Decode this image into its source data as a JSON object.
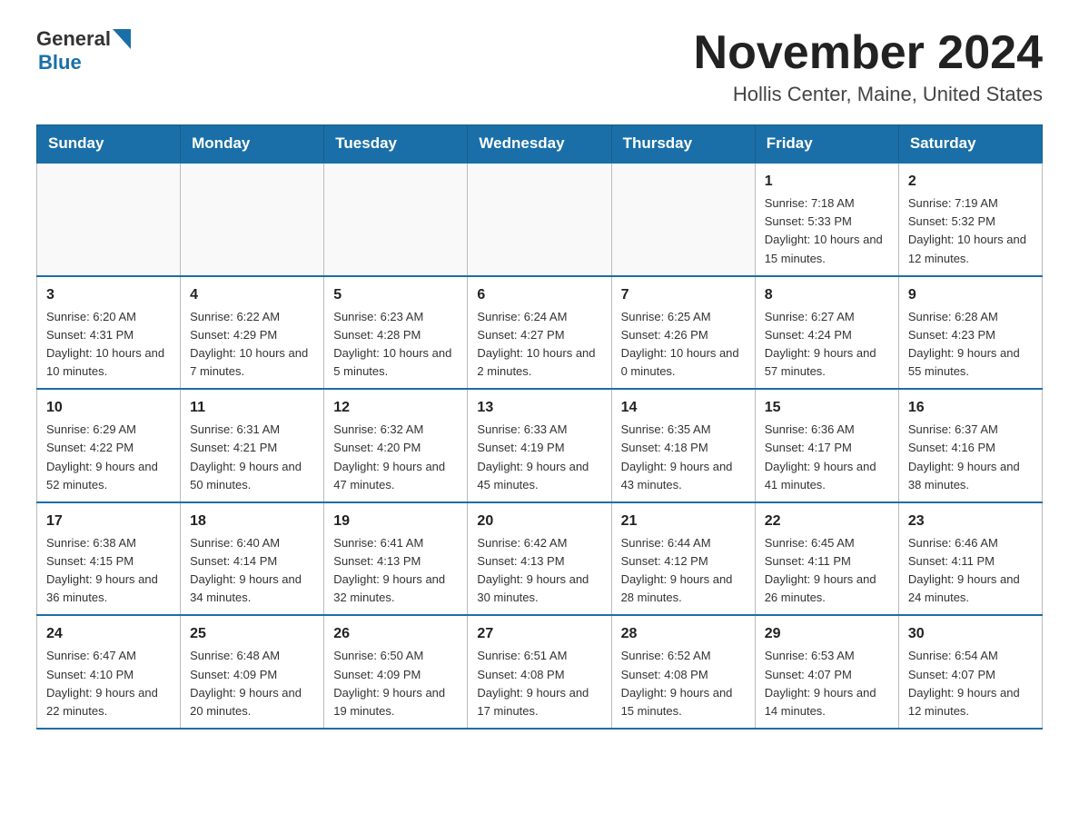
{
  "header": {
    "logo_general": "General",
    "logo_blue": "Blue",
    "month_title": "November 2024",
    "location": "Hollis Center, Maine, United States"
  },
  "days_of_week": [
    "Sunday",
    "Monday",
    "Tuesday",
    "Wednesday",
    "Thursday",
    "Friday",
    "Saturday"
  ],
  "weeks": [
    [
      {
        "day": "",
        "info": ""
      },
      {
        "day": "",
        "info": ""
      },
      {
        "day": "",
        "info": ""
      },
      {
        "day": "",
        "info": ""
      },
      {
        "day": "",
        "info": ""
      },
      {
        "day": "1",
        "info": "Sunrise: 7:18 AM\nSunset: 5:33 PM\nDaylight: 10 hours and 15 minutes."
      },
      {
        "day": "2",
        "info": "Sunrise: 7:19 AM\nSunset: 5:32 PM\nDaylight: 10 hours and 12 minutes."
      }
    ],
    [
      {
        "day": "3",
        "info": "Sunrise: 6:20 AM\nSunset: 4:31 PM\nDaylight: 10 hours and 10 minutes."
      },
      {
        "day": "4",
        "info": "Sunrise: 6:22 AM\nSunset: 4:29 PM\nDaylight: 10 hours and 7 minutes."
      },
      {
        "day": "5",
        "info": "Sunrise: 6:23 AM\nSunset: 4:28 PM\nDaylight: 10 hours and 5 minutes."
      },
      {
        "day": "6",
        "info": "Sunrise: 6:24 AM\nSunset: 4:27 PM\nDaylight: 10 hours and 2 minutes."
      },
      {
        "day": "7",
        "info": "Sunrise: 6:25 AM\nSunset: 4:26 PM\nDaylight: 10 hours and 0 minutes."
      },
      {
        "day": "8",
        "info": "Sunrise: 6:27 AM\nSunset: 4:24 PM\nDaylight: 9 hours and 57 minutes."
      },
      {
        "day": "9",
        "info": "Sunrise: 6:28 AM\nSunset: 4:23 PM\nDaylight: 9 hours and 55 minutes."
      }
    ],
    [
      {
        "day": "10",
        "info": "Sunrise: 6:29 AM\nSunset: 4:22 PM\nDaylight: 9 hours and 52 minutes."
      },
      {
        "day": "11",
        "info": "Sunrise: 6:31 AM\nSunset: 4:21 PM\nDaylight: 9 hours and 50 minutes."
      },
      {
        "day": "12",
        "info": "Sunrise: 6:32 AM\nSunset: 4:20 PM\nDaylight: 9 hours and 47 minutes."
      },
      {
        "day": "13",
        "info": "Sunrise: 6:33 AM\nSunset: 4:19 PM\nDaylight: 9 hours and 45 minutes."
      },
      {
        "day": "14",
        "info": "Sunrise: 6:35 AM\nSunset: 4:18 PM\nDaylight: 9 hours and 43 minutes."
      },
      {
        "day": "15",
        "info": "Sunrise: 6:36 AM\nSunset: 4:17 PM\nDaylight: 9 hours and 41 minutes."
      },
      {
        "day": "16",
        "info": "Sunrise: 6:37 AM\nSunset: 4:16 PM\nDaylight: 9 hours and 38 minutes."
      }
    ],
    [
      {
        "day": "17",
        "info": "Sunrise: 6:38 AM\nSunset: 4:15 PM\nDaylight: 9 hours and 36 minutes."
      },
      {
        "day": "18",
        "info": "Sunrise: 6:40 AM\nSunset: 4:14 PM\nDaylight: 9 hours and 34 minutes."
      },
      {
        "day": "19",
        "info": "Sunrise: 6:41 AM\nSunset: 4:13 PM\nDaylight: 9 hours and 32 minutes."
      },
      {
        "day": "20",
        "info": "Sunrise: 6:42 AM\nSunset: 4:13 PM\nDaylight: 9 hours and 30 minutes."
      },
      {
        "day": "21",
        "info": "Sunrise: 6:44 AM\nSunset: 4:12 PM\nDaylight: 9 hours and 28 minutes."
      },
      {
        "day": "22",
        "info": "Sunrise: 6:45 AM\nSunset: 4:11 PM\nDaylight: 9 hours and 26 minutes."
      },
      {
        "day": "23",
        "info": "Sunrise: 6:46 AM\nSunset: 4:11 PM\nDaylight: 9 hours and 24 minutes."
      }
    ],
    [
      {
        "day": "24",
        "info": "Sunrise: 6:47 AM\nSunset: 4:10 PM\nDaylight: 9 hours and 22 minutes."
      },
      {
        "day": "25",
        "info": "Sunrise: 6:48 AM\nSunset: 4:09 PM\nDaylight: 9 hours and 20 minutes."
      },
      {
        "day": "26",
        "info": "Sunrise: 6:50 AM\nSunset: 4:09 PM\nDaylight: 9 hours and 19 minutes."
      },
      {
        "day": "27",
        "info": "Sunrise: 6:51 AM\nSunset: 4:08 PM\nDaylight: 9 hours and 17 minutes."
      },
      {
        "day": "28",
        "info": "Sunrise: 6:52 AM\nSunset: 4:08 PM\nDaylight: 9 hours and 15 minutes."
      },
      {
        "day": "29",
        "info": "Sunrise: 6:53 AM\nSunset: 4:07 PM\nDaylight: 9 hours and 14 minutes."
      },
      {
        "day": "30",
        "info": "Sunrise: 6:54 AM\nSunset: 4:07 PM\nDaylight: 9 hours and 12 minutes."
      }
    ]
  ]
}
